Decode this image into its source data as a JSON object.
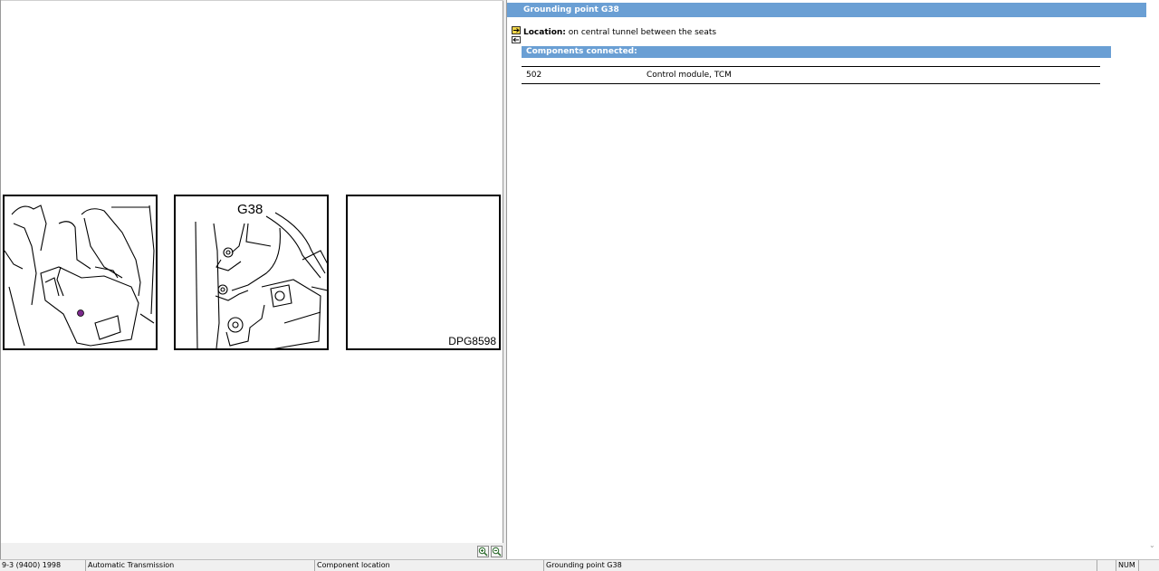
{
  "detail": {
    "title": "Grounding point G38",
    "location_label": "Location:",
    "location_text": "on central tunnel between the seats",
    "components_header": "Components connected:",
    "components": [
      {
        "number": "502",
        "name": "Control module, TCM"
      }
    ]
  },
  "illustration": {
    "callout": "G38",
    "code": "DPG8598"
  },
  "icons": {
    "zoom_in": "zoom-in-icon",
    "zoom_out": "zoom-out-icon",
    "location": "location-icon"
  },
  "statusbar": {
    "model": "9-3 (9400) 1998",
    "system": "Automatic Transmission",
    "view": "Component location",
    "item": "Grounding point G38",
    "num": "NUM"
  },
  "colors": {
    "header_blue": "#6a9fd4",
    "marker": "#7b2a8c"
  }
}
